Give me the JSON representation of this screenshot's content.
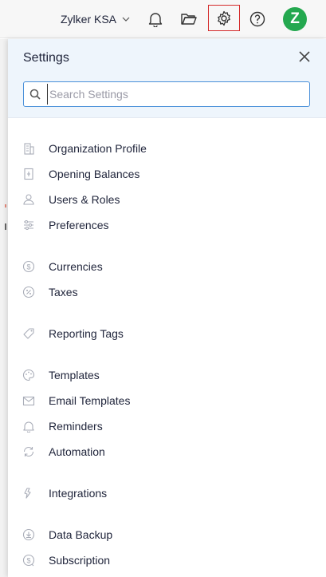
{
  "header": {
    "org_name": "Zylker KSA",
    "avatar_letter": "Z"
  },
  "settings": {
    "title": "Settings",
    "search_placeholder": "Search Settings",
    "items": [
      {
        "label": "Organization Profile",
        "icon": "building-icon"
      },
      {
        "label": "Opening Balances",
        "icon": "ledger-icon"
      },
      {
        "label": "Users & Roles",
        "icon": "users-icon"
      },
      {
        "label": "Preferences",
        "icon": "sliders-icon"
      },
      {
        "label": "Currencies",
        "icon": "currency-icon"
      },
      {
        "label": "Taxes",
        "icon": "percent-icon"
      },
      {
        "label": "Reporting Tags",
        "icon": "tag-icon"
      },
      {
        "label": "Templates",
        "icon": "palette-icon"
      },
      {
        "label": "Email Templates",
        "icon": "mail-icon"
      },
      {
        "label": "Reminders",
        "icon": "bell-icon"
      },
      {
        "label": "Automation",
        "icon": "refresh-icon"
      },
      {
        "label": "Integrations",
        "icon": "plug-icon"
      },
      {
        "label": "Data Backup",
        "icon": "download-icon"
      },
      {
        "label": "Subscription",
        "icon": "subscription-icon"
      }
    ]
  }
}
